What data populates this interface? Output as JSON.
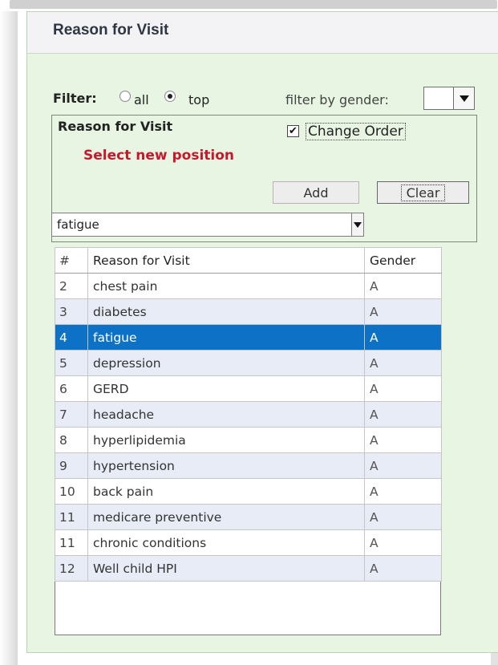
{
  "panel": {
    "title": "Reason for Visit"
  },
  "filter": {
    "label": "Filter:",
    "options": [
      {
        "label": "all",
        "checked": false
      },
      {
        "label": "top",
        "checked": true
      }
    ],
    "gender_label": "filter by gender:",
    "gender_value": ""
  },
  "editor": {
    "title": "Reason for Visit",
    "change_order_label": "Change Order",
    "change_order_checked": true,
    "message": "Select new position",
    "add_label": "Add",
    "clear_label": "Clear",
    "reason_value": "fatigue"
  },
  "table": {
    "columns": [
      "#",
      "Reason for Visit",
      "Gender"
    ],
    "rows": [
      {
        "num": "2",
        "reason": "chest pain",
        "gender": "A"
      },
      {
        "num": "3",
        "reason": "diabetes",
        "gender": "A"
      },
      {
        "num": "4",
        "reason": "fatigue",
        "gender": "A",
        "selected": true
      },
      {
        "num": "5",
        "reason": "depression",
        "gender": "A"
      },
      {
        "num": "6",
        "reason": "GERD",
        "gender": "A"
      },
      {
        "num": "7",
        "reason": "headache",
        "gender": "A"
      },
      {
        "num": "8",
        "reason": "hyperlipidemia",
        "gender": "A"
      },
      {
        "num": "9",
        "reason": "hypertension",
        "gender": "A"
      },
      {
        "num": "10",
        "reason": "back pain",
        "gender": "A"
      },
      {
        "num": "11",
        "reason": "medicare preventive",
        "gender": "A"
      },
      {
        "num": "11",
        "reason": "chronic conditions",
        "gender": "A"
      },
      {
        "num": "12",
        "reason": "Well child HPI",
        "gender": "A"
      }
    ]
  },
  "colors": {
    "panel_bg": "#e8f5e3",
    "selected_row": "#0d72c6",
    "alt_row": "#e8ecf7",
    "message": "#c8182c"
  }
}
